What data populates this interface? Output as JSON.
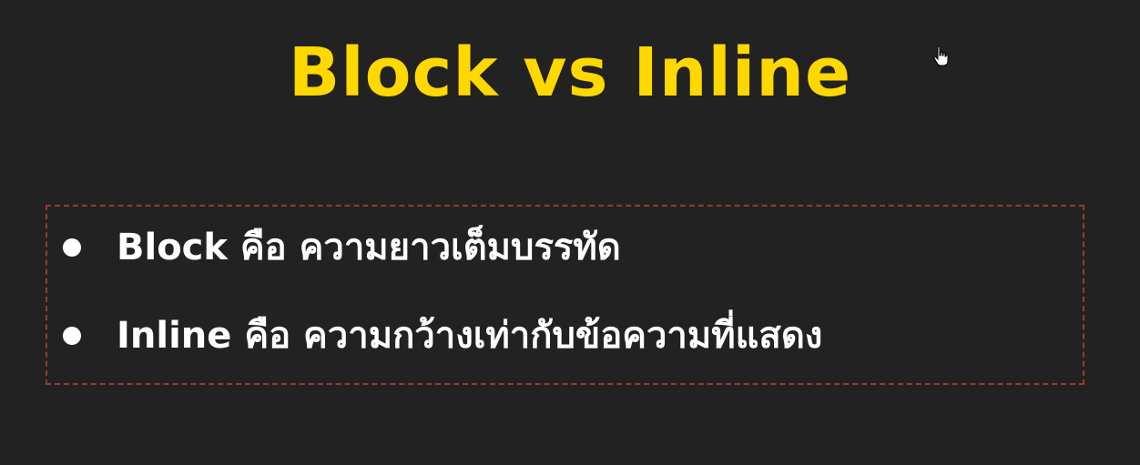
{
  "slide": {
    "title": "Block vs Inline",
    "bullets": [
      {
        "text": "Block คือ ความยาวเต็มบรรทัด"
      },
      {
        "text": "Inline คือ ความกว้างเท่ากับข้อความที่แสดง"
      }
    ],
    "cursor_icon": "hand-pointer-icon"
  },
  "colors": {
    "background": "#222222",
    "title": "#ffd800",
    "text": "#ffffff",
    "box_border": "#9a3a2a"
  }
}
